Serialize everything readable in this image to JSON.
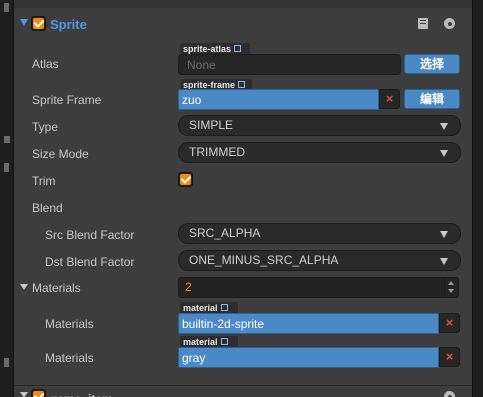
{
  "sprite_component": {
    "title": "Sprite",
    "enabled": true,
    "properties": {
      "atlas": {
        "label": "Atlas",
        "tag": "sprite-atlas",
        "value": "None",
        "button": "选择"
      },
      "sprite_frame": {
        "label": "Sprite Frame",
        "tag": "sprite-frame",
        "value": "zuo",
        "clear": "×",
        "button": "编辑"
      },
      "type": {
        "label": "Type",
        "value": "SIMPLE"
      },
      "size_mode": {
        "label": "Size Mode",
        "value": "TRIMMED"
      },
      "trim": {
        "label": "Trim",
        "checked": true
      },
      "blend": {
        "label": "Blend",
        "src": {
          "label": "Src Blend Factor",
          "value": "SRC_ALPHA"
        },
        "dst": {
          "label": "Dst Blend Factor",
          "value": "ONE_MINUS_SRC_ALPHA"
        }
      },
      "materials": {
        "label": "Materials",
        "count": "2",
        "items": [
          {
            "label": "Materials",
            "tag": "material",
            "value": "builtin-2d-sprite",
            "clear": "×"
          },
          {
            "label": "Materials",
            "tag": "material",
            "value": "gray",
            "clear": "×"
          }
        ]
      }
    }
  },
  "next_component": {
    "title": "game_item"
  },
  "icons": {
    "doc": "book-icon",
    "settings": "gear-icon",
    "external": "external-link-icon"
  },
  "colors": {
    "accent": "#4a9ae8",
    "asset_field": "#4a88c6",
    "check": "#f08c12",
    "clear": "#e04a4a"
  }
}
